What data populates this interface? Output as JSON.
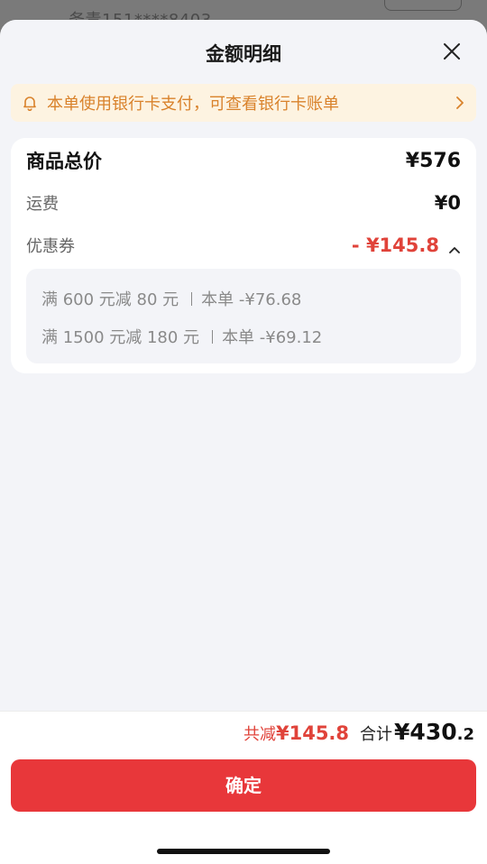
{
  "backdrop": {
    "peek_text": "务责151****8403"
  },
  "sheet": {
    "title": "金额明细"
  },
  "notice": {
    "text": "本单使用银行卡支付，可查看银行卡账单"
  },
  "details": {
    "goods_total_label": "商品总价",
    "goods_total_value": "¥576",
    "shipping_label": "运费",
    "shipping_value": "¥0",
    "coupon_label": "优惠券",
    "coupon_value": "- ¥145.8",
    "coupons": [
      {
        "rule": "满 600 元减 80 元",
        "amount": "本单 -¥76.68"
      },
      {
        "rule": "满 1500 元减 180 元",
        "amount": "本单 -¥69.12"
      }
    ]
  },
  "summary": {
    "saved_label": "共减",
    "saved_value": "¥145.8",
    "total_label": "合计",
    "total_int": "¥430",
    "total_dec": ".2"
  },
  "confirm_label": "确定",
  "colors": {
    "accent_red": "#e8373a",
    "notice_orange": "#d9822b",
    "notice_bg": "#fdf3e1"
  }
}
